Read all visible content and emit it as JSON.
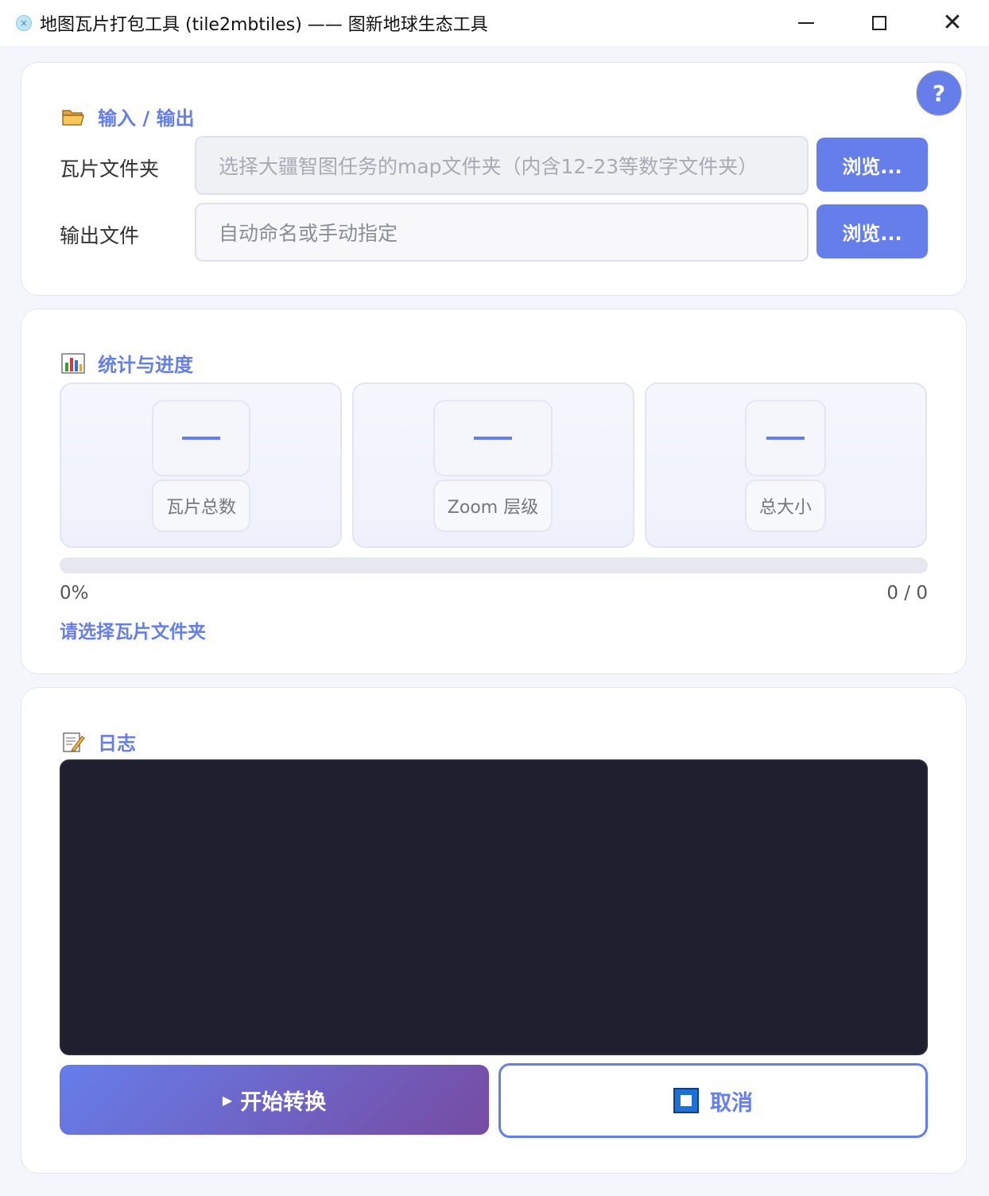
{
  "window": {
    "title": "地图瓦片打包工具 (tile2mbtiles) —— 图新地球生态工具",
    "app_icon": "×"
  },
  "help": {
    "label": "?"
  },
  "io": {
    "title": "输入 / 输出",
    "icon": "folder-icon",
    "tile_folder": {
      "label": "瓦片文件夹",
      "value": "",
      "placeholder": "选择大疆智图任务的map文件夹（内含12-23等数字文件夹）",
      "browse_label": "浏览..."
    },
    "output_file": {
      "label": "输出文件",
      "value": "",
      "placeholder": "自动命名或手动指定",
      "browse_label": "浏览..."
    }
  },
  "stats": {
    "title": "统计与进度",
    "icon": "bar-chart-icon",
    "items": [
      {
        "label": "瓦片总数",
        "value": "—"
      },
      {
        "label": "Zoom 层级",
        "value": "—"
      },
      {
        "label": "总大小",
        "value": "—"
      }
    ],
    "progress_percent": 0,
    "percent_text": "0%",
    "count_text": "0 / 0",
    "status": "请选择瓦片文件夹"
  },
  "log": {
    "title": "日志",
    "icon": "memo-icon",
    "content": ""
  },
  "actions": {
    "start_label": "开始转换",
    "cancel_label": "取消"
  },
  "colors": {
    "accent": "#667eea",
    "gradient_end": "#764ba2",
    "log_bg": "#1f1f2f"
  }
}
